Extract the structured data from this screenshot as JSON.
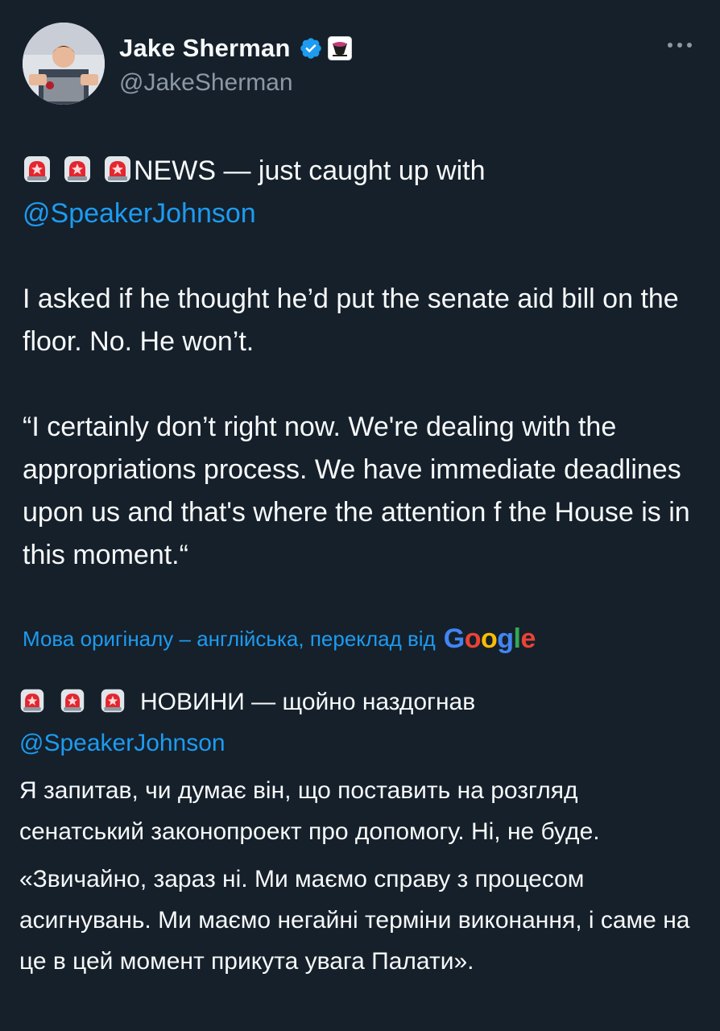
{
  "author": {
    "name": "Jake Sherman",
    "handle": "@JakeSherman",
    "verified_icon": "verified-badge-icon",
    "affiliation_icon": "affiliation-logo-icon"
  },
  "tweet": {
    "line1_text": "NEWS — just caught up with",
    "mention": "@SpeakerJohnson",
    "paragraph2": "I asked if he thought he’d put the senate aid bill on the floor. No. He won’t.",
    "paragraph3": "“I certainly don’t right now. We're dealing with the appropriations process. We have immediate deadlines upon us and that's where the attention f the House is in this moment.“"
  },
  "translation": {
    "label": "Мова оригіналу – англійська, переклад від",
    "provider": {
      "G": "G",
      "o1": "o",
      "o2": "o",
      "g": "g",
      "l": "l",
      "e": "e"
    },
    "line1_text": "НОВИНИ — щойно наздогнав",
    "mention": "@SpeakerJohnson",
    "paragraph2": "Я запитав, чи думає він, що поставить на розгляд сенатський законопроект про допомогу. Ні, не буде.",
    "paragraph3": "«Звичайно, зараз ні. Ми маємо справу з процесом асигнувань. Ми маємо негайні терміни виконання, і саме на це в цей момент прикута увага Палати»."
  },
  "colors": {
    "background": "#15202b",
    "text": "#f7f9f9",
    "secondary": "#8b98a5",
    "link": "#1d9bf0"
  }
}
